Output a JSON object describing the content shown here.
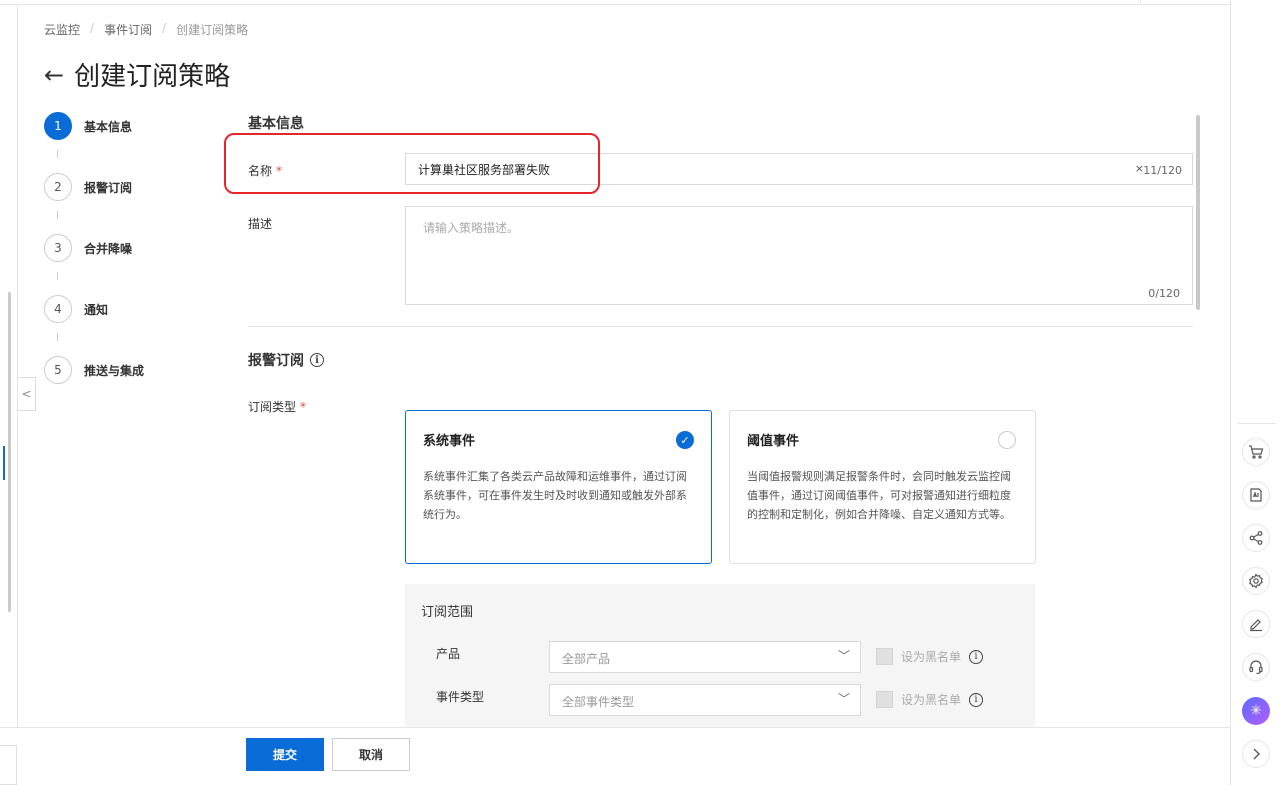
{
  "breadcrumb": [
    "云监控",
    "事件订阅",
    "创建订阅策略"
  ],
  "breadcrumb_sep": "/",
  "page": {
    "title": "创建订阅策略",
    "back": "←"
  },
  "steps": [
    {
      "num": "1",
      "label": "基本信息",
      "active": true
    },
    {
      "num": "2",
      "label": "报警订阅",
      "active": false
    },
    {
      "num": "3",
      "label": "合并降噪",
      "active": false
    },
    {
      "num": "4",
      "label": "通知",
      "active": false
    },
    {
      "num": "5",
      "label": "推送与集成",
      "active": false
    }
  ],
  "basic": {
    "section_title": "基本信息",
    "name_label": "名称",
    "name_value": "计算巢社区服务部署失败",
    "name_count": "11/120",
    "clear": "×",
    "desc_label": "描述",
    "desc_placeholder": "请输入策略描述。",
    "desc_count": "0/120",
    "required": "*"
  },
  "alert": {
    "section_title": "报警订阅",
    "info": "i",
    "type_label": "订阅类型",
    "cards": [
      {
        "title": "系统事件",
        "desc": "系统事件汇集了各类云产品故障和运维事件，通过订阅系统事件，可在事件发生时及时收到通知或触发外部系统行为。",
        "selected": true,
        "check": "✓"
      },
      {
        "title": "阈值事件",
        "desc": "当阈值报警规则满足报警条件时，会同时触发云监控阈值事件，通过订阅阈值事件，可对报警通知进行细粒度的控制和定制化，例如合并降噪、自定义通知方式等。",
        "selected": false
      }
    ],
    "scope": {
      "title": "订阅范围",
      "rows": [
        {
          "label": "产品",
          "placeholder": "全部产品",
          "blacklist": "设为黑名单"
        },
        {
          "label": "事件类型",
          "placeholder": "全部事件类型",
          "blacklist": "设为黑名单"
        }
      ]
    }
  },
  "footer": {
    "submit": "提交",
    "cancel": "取消"
  },
  "colors": {
    "primary": "#0a6cd6",
    "required": "#e84b3c",
    "highlight": "#e8242b"
  },
  "right_toolbar": [
    "cart-icon",
    "api-icon",
    "share-icon",
    "settings-icon",
    "edit-icon",
    "support-icon",
    "ai-assistant-icon",
    "expand-icon"
  ]
}
